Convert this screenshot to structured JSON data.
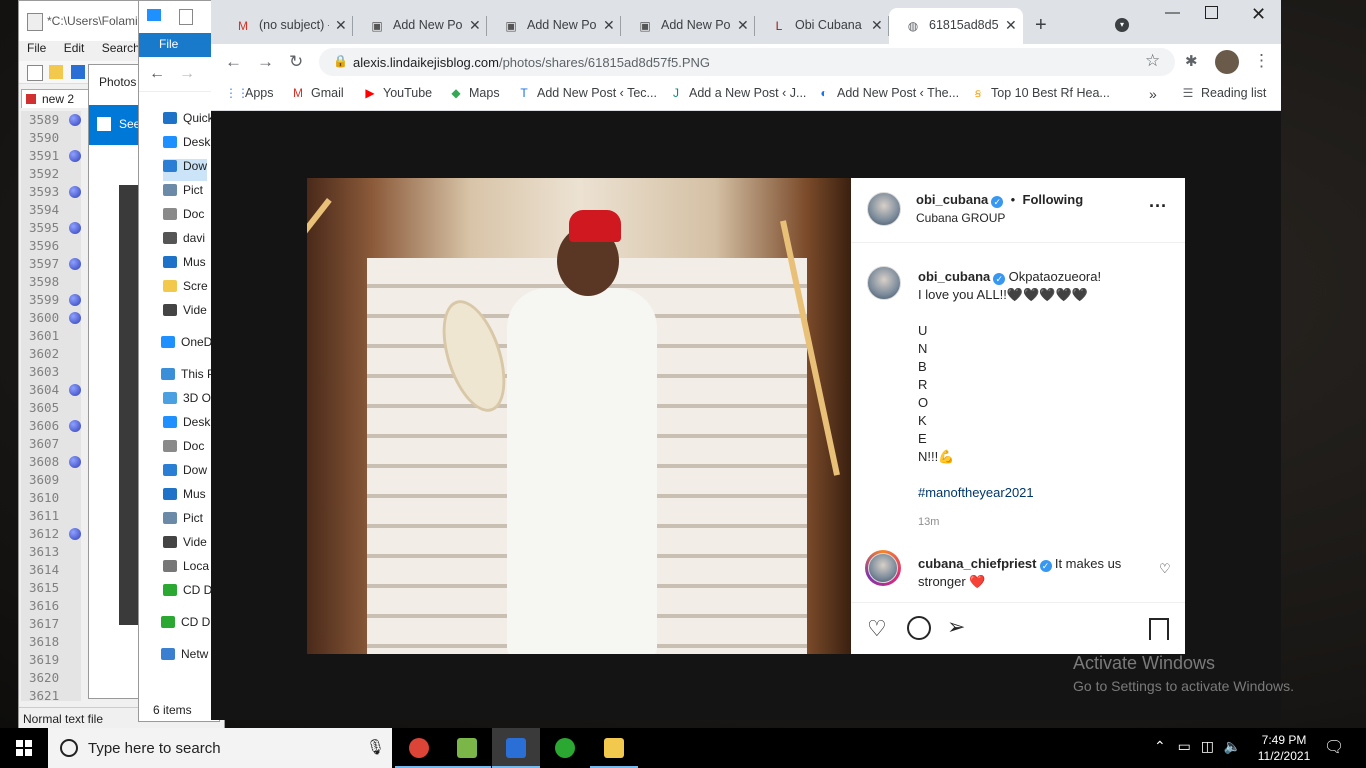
{
  "notepad": {
    "title": "*C:\\Users\\Folami",
    "menu": [
      "File",
      "Edit",
      "Search"
    ],
    "tab": "new 2",
    "lines": [
      {
        "n": "3589",
        "bm": true
      },
      {
        "n": "3590",
        "bm": false
      },
      {
        "n": "3591",
        "bm": true
      },
      {
        "n": "3592",
        "bm": false
      },
      {
        "n": "3593",
        "bm": true
      },
      {
        "n": "3594",
        "bm": false
      },
      {
        "n": "3595",
        "bm": true
      },
      {
        "n": "3596",
        "bm": false
      },
      {
        "n": "3597",
        "bm": true
      },
      {
        "n": "3598",
        "bm": false
      },
      {
        "n": "3599",
        "bm": true
      },
      {
        "n": "3600",
        "bm": true
      },
      {
        "n": "3601",
        "bm": false
      },
      {
        "n": "3602",
        "bm": false
      },
      {
        "n": "3603",
        "bm": false
      },
      {
        "n": "3604",
        "bm": true
      },
      {
        "n": "3605",
        "bm": false
      },
      {
        "n": "3606",
        "bm": true
      },
      {
        "n": "3607",
        "bm": false
      },
      {
        "n": "3608",
        "bm": true
      },
      {
        "n": "3609",
        "bm": false
      },
      {
        "n": "3610",
        "bm": false
      },
      {
        "n": "3611",
        "bm": false
      },
      {
        "n": "3612",
        "bm": true
      },
      {
        "n": "3613",
        "bm": false
      },
      {
        "n": "3614",
        "bm": false
      },
      {
        "n": "3615",
        "bm": false
      },
      {
        "n": "3616",
        "bm": false
      },
      {
        "n": "3617",
        "bm": false
      },
      {
        "n": "3618",
        "bm": false
      },
      {
        "n": "3619",
        "bm": false
      },
      {
        "n": "3620",
        "bm": false
      },
      {
        "n": "3621",
        "bm": false
      }
    ],
    "status": "Normal text file"
  },
  "photos": {
    "title": "Photos",
    "see_label": "See"
  },
  "explorer": {
    "ribbon_file": "File",
    "items": [
      {
        "label": "Quick",
        "icon": "star-icon",
        "color": "#1e73c8"
      },
      {
        "label": "Desk",
        "icon": "desktop-icon",
        "color": "#1e90ff"
      },
      {
        "label": "Dow",
        "icon": "download-icon",
        "color": "#2a7fd4",
        "selected": true
      },
      {
        "label": "Pict",
        "icon": "pictures-icon",
        "color": "#6a8aa8"
      },
      {
        "label": "Doc",
        "icon": "document-icon",
        "color": "#8a8a8a"
      },
      {
        "label": "davi",
        "icon": "search-icon",
        "color": "#555"
      },
      {
        "label": "Mus",
        "icon": "music-icon",
        "color": "#1e73c8"
      },
      {
        "label": "Scre",
        "icon": "folder-icon",
        "color": "#f2c94c"
      },
      {
        "label": "Vide",
        "icon": "video-icon",
        "color": "#444"
      },
      {
        "label": "OneD",
        "icon": "cloud-icon",
        "color": "#1e90ff"
      },
      {
        "label": "This P",
        "icon": "computer-icon",
        "color": "#3a8fd8"
      },
      {
        "label": "3D O",
        "icon": "cube-icon",
        "color": "#4aa0e0"
      },
      {
        "label": "Desk",
        "icon": "desktop-icon",
        "color": "#1e90ff"
      },
      {
        "label": "Doc",
        "icon": "document-icon",
        "color": "#8a8a8a"
      },
      {
        "label": "Dow",
        "icon": "download-icon",
        "color": "#2a7fd4"
      },
      {
        "label": "Mus",
        "icon": "music-icon",
        "color": "#1e73c8"
      },
      {
        "label": "Pict",
        "icon": "pictures-icon",
        "color": "#6a8aa8"
      },
      {
        "label": "Vide",
        "icon": "video-icon",
        "color": "#444"
      },
      {
        "label": "Loca",
        "icon": "drive-icon",
        "color": "#777"
      },
      {
        "label": "CD D",
        "icon": "glo-icon",
        "color": "#2aa832"
      },
      {
        "label": "CD D",
        "icon": "glo-icon",
        "color": "#2aa832"
      },
      {
        "label": "Netw",
        "icon": "network-icon",
        "color": "#3a7fd0"
      }
    ],
    "footer": "6 items"
  },
  "chrome": {
    "tabs": [
      {
        "label": "(no subject) -",
        "favicon": "gmail-icon",
        "favcolor": "#d93025",
        "fav": "M"
      },
      {
        "label": "Add New Pos",
        "favicon": "page-icon",
        "favcolor": "#555",
        "fav": "▣"
      },
      {
        "label": "Add New Pos",
        "favicon": "page-icon",
        "favcolor": "#555",
        "fav": "▣"
      },
      {
        "label": "Add New Pos",
        "favicon": "page-icon",
        "favcolor": "#555",
        "fav": "▣"
      },
      {
        "label": "Obi Cubana",
        "favicon": "lib-icon",
        "favcolor": "#a01c1c",
        "fav": "L"
      },
      {
        "label": "61815ad8d5",
        "favicon": "globe-icon",
        "favcolor": "#5f6368",
        "fav": "◍",
        "active": true
      }
    ],
    "url_host": "alexis.lindaikejisblog.com",
    "url_path": "/photos/shares/61815ad8d57f5.PNG",
    "bookmarks": [
      {
        "label": "Apps",
        "icon": "apps-icon",
        "glyph": "⋮⋮",
        "color": "#4285f4"
      },
      {
        "label": "Gmail",
        "icon": "gmail-icon",
        "glyph": "M",
        "color": "#d93025"
      },
      {
        "label": "YouTube",
        "icon": "youtube-icon",
        "glyph": "▶",
        "color": "#ff0000"
      },
      {
        "label": "Maps",
        "icon": "maps-icon",
        "glyph": "◆",
        "color": "#34a853"
      },
      {
        "label": "Add New Post ‹ Tec...",
        "icon": "tec-icon",
        "glyph": "T",
        "color": "#1a73e8"
      },
      {
        "label": "Add a New Post ‹ J...",
        "icon": "jbk-icon",
        "glyph": "J",
        "color": "#0a8a7a"
      },
      {
        "label": "Add New Post ‹ The...",
        "icon": "the-icon",
        "glyph": "◐",
        "color": "#1a73e8"
      },
      {
        "label": "Top 10 Best Rf Hea...",
        "icon": "top10-icon",
        "glyph": "ꞩ",
        "color": "#f5a623"
      }
    ],
    "reading_list": "Reading list"
  },
  "instagram": {
    "header_user": "obi_cubana",
    "follow_state": "Following",
    "header_subtitle": "Cubana GROUP",
    "caption_user": "obi_cubana",
    "caption_lines": [
      "Okpataozueora!",
      "I love you ALL!!🖤🖤🖤🖤🖤",
      "",
      "U",
      "N",
      "B",
      "R",
      "O",
      "K",
      "E",
      "N!!!💪",
      "",
      "#manoftheyear2021"
    ],
    "time": "13m",
    "comment_user": "cubana_chiefpriest",
    "comment_text": "It makes us",
    "comment_text2": "stronger ❤️"
  },
  "watermark": {
    "line1": "Activate Windows",
    "line2": "Go to Settings to activate Windows."
  },
  "taskbar": {
    "search_placeholder": "Type here to search",
    "apps": [
      {
        "name": "chrome",
        "color": "#db4437",
        "active": true
      },
      {
        "name": "notepadpp",
        "color": "#7ab648",
        "active": true
      },
      {
        "name": "photos",
        "color": "#2a6fd6",
        "active": true
      },
      {
        "name": "glo",
        "color": "#2aa832",
        "active": false
      },
      {
        "name": "file-explorer",
        "color": "#f2c94c",
        "active": true
      }
    ],
    "time": "7:49 PM",
    "date": "11/2/2021"
  }
}
